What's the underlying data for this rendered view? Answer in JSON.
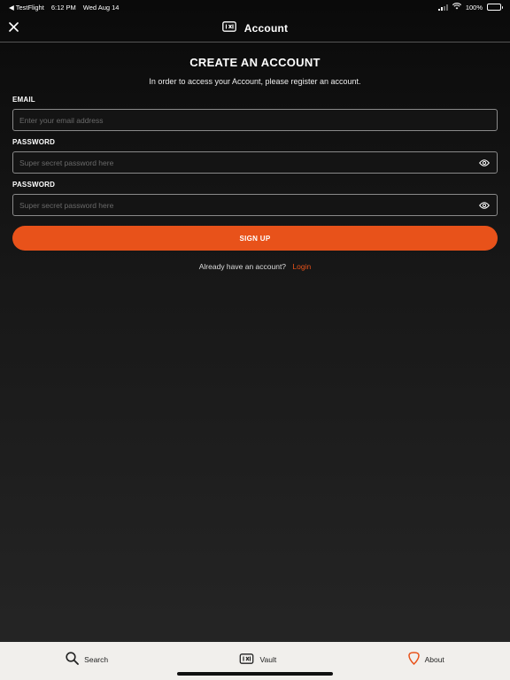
{
  "status_bar": {
    "back_app": "◀ TestFlight",
    "time": "6:12 PM",
    "date": "Wed Aug 14",
    "battery": "100%"
  },
  "nav": {
    "title": "Account"
  },
  "form": {
    "heading": "CREATE AN ACCOUNT",
    "subheading": "In order to access your Account, please register an account.",
    "email_label": "EMAIL",
    "email_placeholder": "Enter your email address",
    "email_value": "",
    "password_label": "PASSWORD",
    "password_placeholder": "Super secret password here",
    "password_value": "",
    "confirm_label": "PASSWORD",
    "confirm_placeholder": "Super secret password here",
    "confirm_value": "",
    "signup_label": "SIGN UP",
    "login_prompt": "Already have an account?",
    "login_link": "Login"
  },
  "tabs": [
    {
      "label": "Search",
      "icon": "search-icon"
    },
    {
      "label": "Vault",
      "icon": "vault-icon"
    },
    {
      "label": "About",
      "icon": "pick-icon"
    }
  ],
  "colors": {
    "accent": "#e8521a",
    "tab_bar_bg": "#f1efec"
  }
}
